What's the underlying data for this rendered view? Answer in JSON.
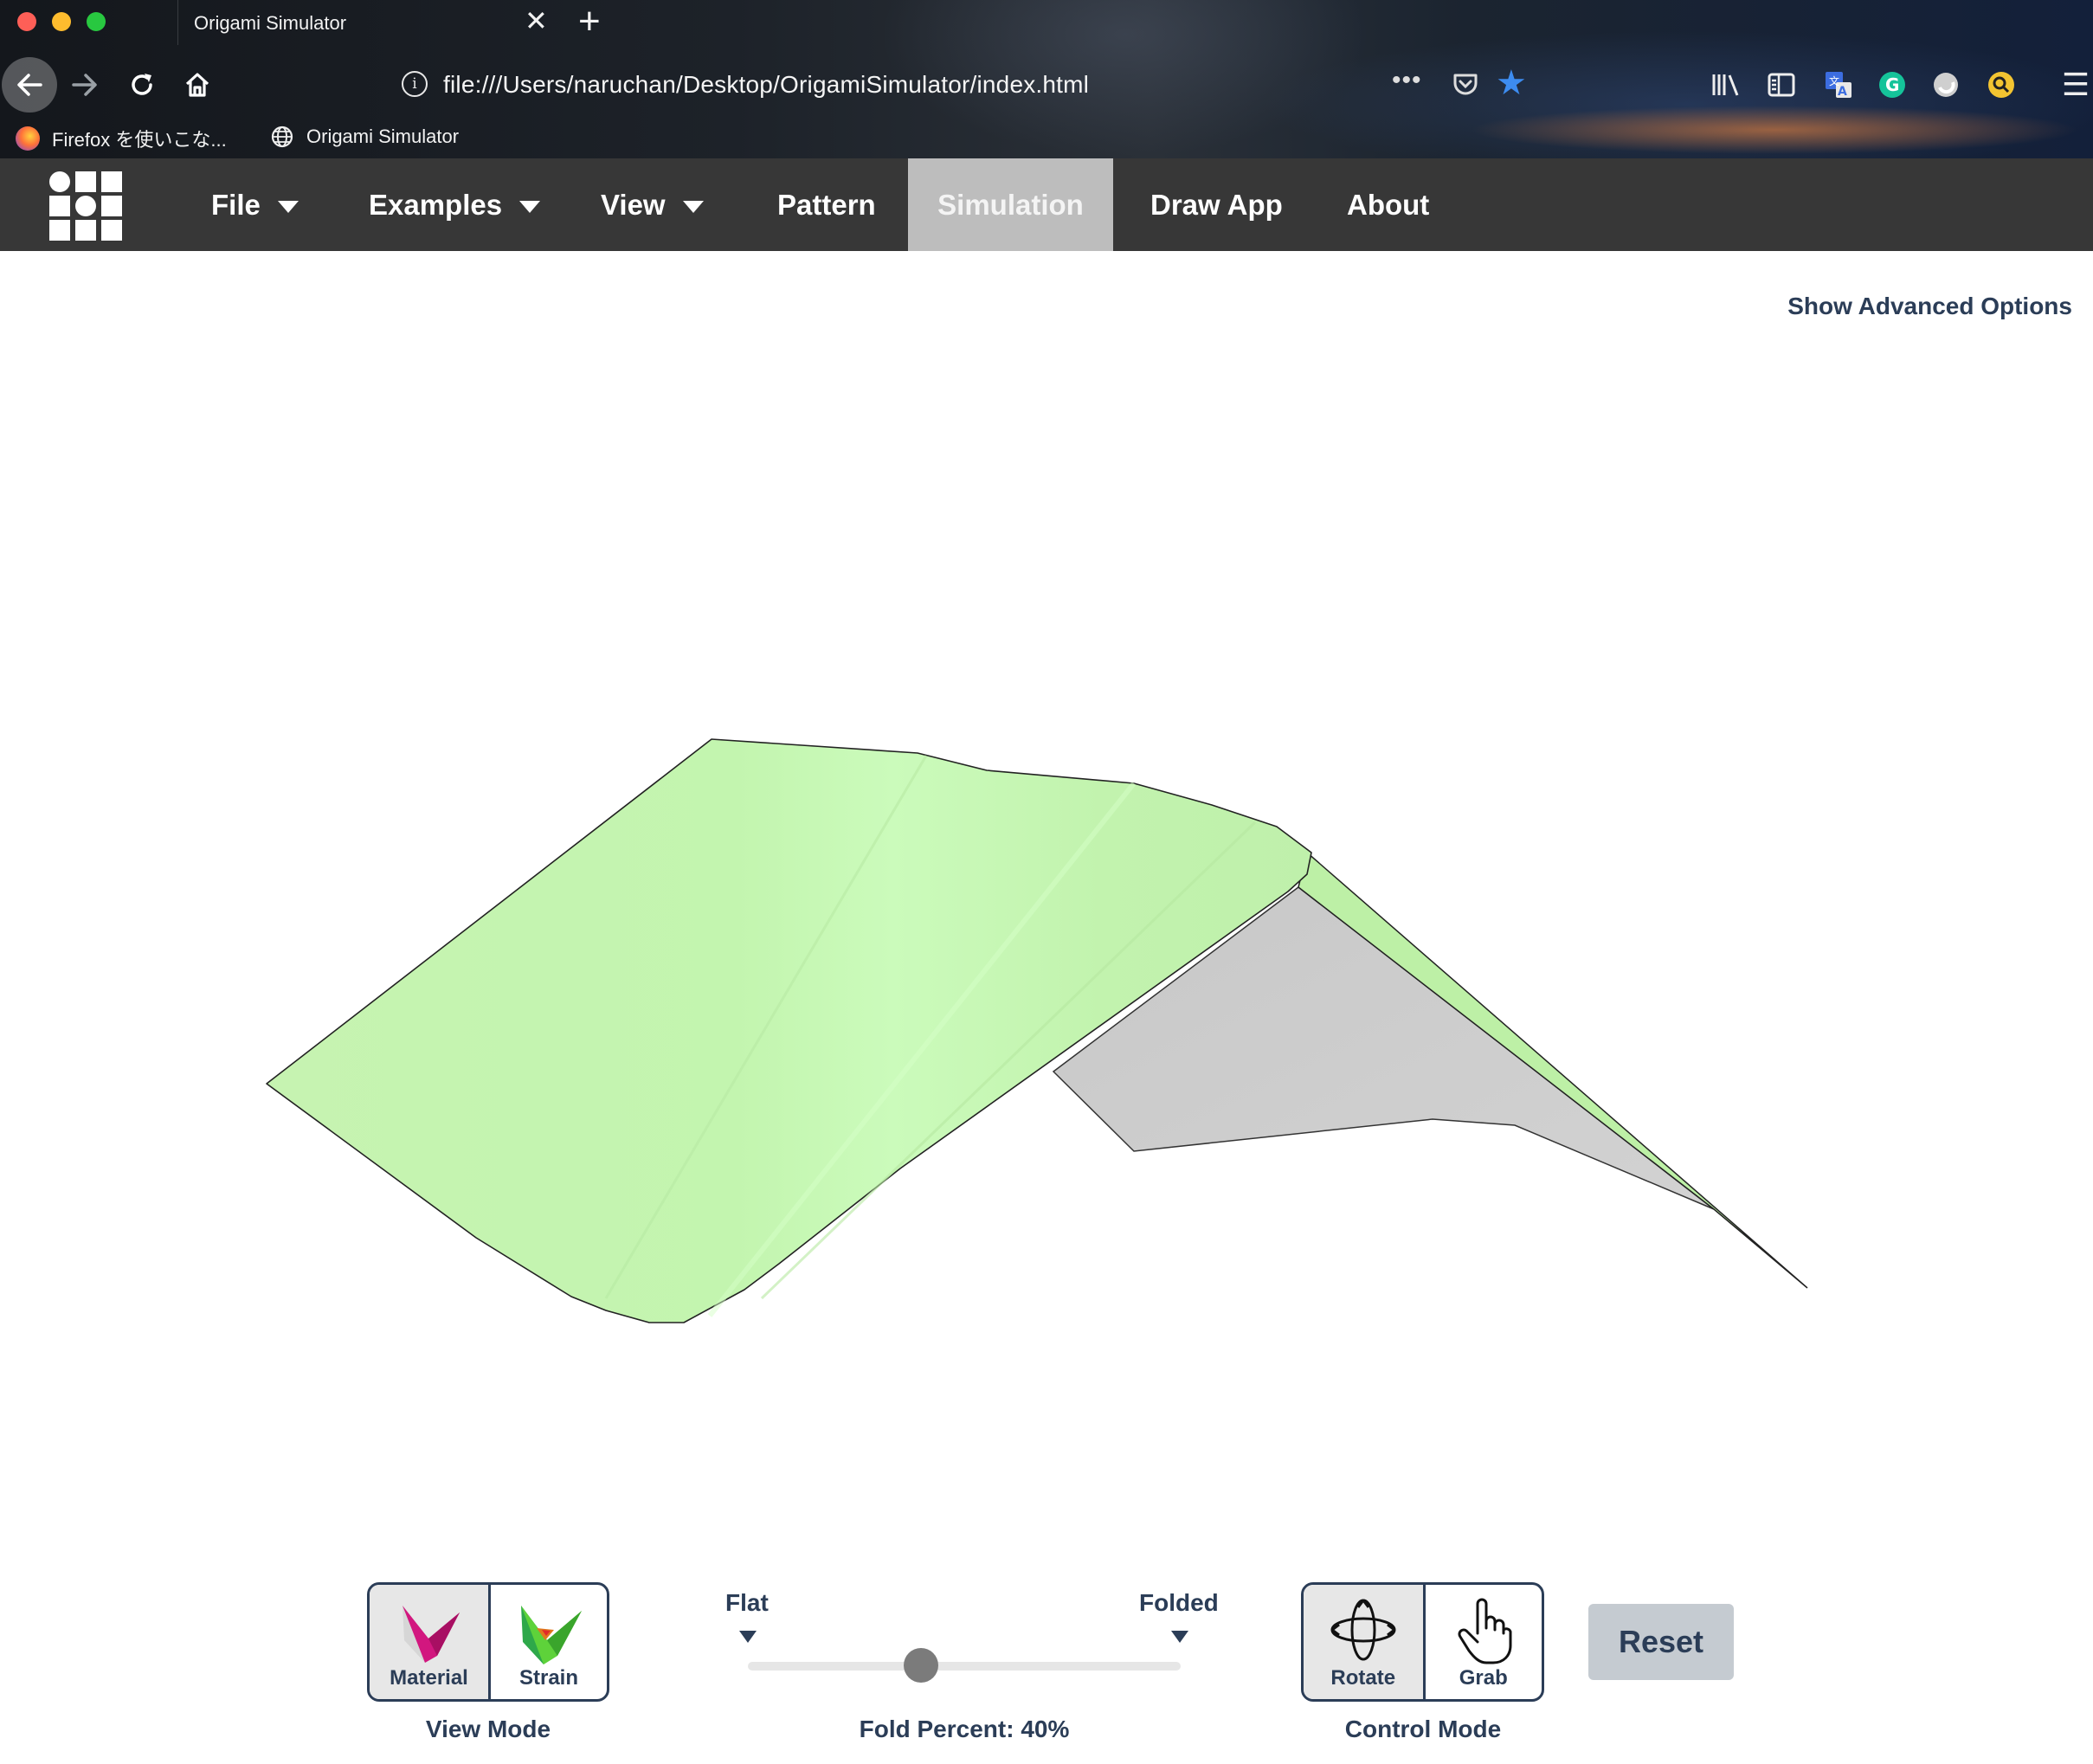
{
  "browser": {
    "tab_title": "Origami Simulator",
    "tab_close_glyph": "✕",
    "new_tab_glyph": "+",
    "url": "file:///Users/naruchan/Desktop/OrigamiSimulator/index.html",
    "url_more_glyph": "•••",
    "bookmarks": [
      {
        "label": "Firefox を使いこな...",
        "icon": "firefox-icon"
      },
      {
        "label": "Origami Simulator",
        "icon": "globe-icon"
      }
    ],
    "toolbar_icons": [
      "back-arrow-icon",
      "forward-arrow-icon",
      "reload-icon",
      "home-icon",
      "info-icon",
      "pocket-icon",
      "bookmark-star-icon",
      "library-icon",
      "sidebar-icon",
      "translate-icon",
      "grammarly-icon",
      "extension-icon",
      "search-extension-icon",
      "hamburger-menu-icon"
    ]
  },
  "app_nav": {
    "items": [
      {
        "label": "File",
        "dropdown": true
      },
      {
        "label": "Examples",
        "dropdown": true
      },
      {
        "label": "View",
        "dropdown": true
      },
      {
        "label": "Pattern",
        "dropdown": false
      },
      {
        "label": "Simulation",
        "dropdown": false,
        "active": true
      },
      {
        "label": "Draw App",
        "dropdown": false
      },
      {
        "label": "About",
        "dropdown": false
      }
    ]
  },
  "advanced_options_label": "Show Advanced Options",
  "view_mode": {
    "caption": "View Mode",
    "buttons": [
      {
        "label": "Material",
        "selected": true
      },
      {
        "label": "Strain",
        "selected": false
      }
    ]
  },
  "fold_slider": {
    "left_label": "Flat",
    "right_label": "Folded",
    "value": 0.4,
    "readout": "Fold Percent: 40%"
  },
  "control_mode": {
    "caption": "Control Mode",
    "buttons": [
      {
        "label": "Rotate",
        "selected": true
      },
      {
        "label": "Grab",
        "selected": false
      }
    ]
  },
  "reset_label": "Reset",
  "colors": {
    "nav_background": "#373737",
    "nav_active": "#bdbdbd",
    "text_dark": "#2b3d57",
    "paper_front": "#c4f4b0",
    "paper_back": "#cfcfcf",
    "slider_handle": "#7b7b7b",
    "reset_button": "#c5cbd1"
  }
}
